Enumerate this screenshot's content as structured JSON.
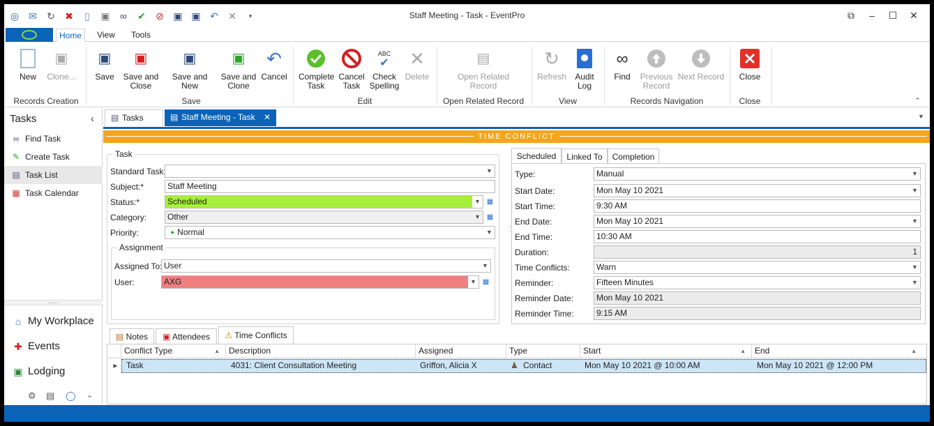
{
  "window": {
    "title": "Staff Meeting - Task - EventPro"
  },
  "ribbon": {
    "tabs": [
      "Home",
      "View",
      "Tools"
    ],
    "buttons": {
      "new": "New",
      "clone": "Clone...",
      "save": "Save",
      "save_close": "Save and\nClose",
      "save_new": "Save and New",
      "save_clone": "Save and\nClone",
      "cancel": "Cancel",
      "complete": "Complete\nTask",
      "cancel_task": "Cancel\nTask",
      "spelling": "Check\nSpelling",
      "delete": "Delete",
      "open_related": "Open Related\nRecord",
      "refresh": "Refresh",
      "audit": "Audit\nLog",
      "find": "Find",
      "prev": "Previous\nRecord",
      "next": "Next Record",
      "close": "Close"
    },
    "groups": {
      "records_creation": "Records Creation",
      "save": "Save",
      "edit": "Edit",
      "open_related": "Open Related Record",
      "view": "View",
      "records_navigation": "Records Navigation",
      "close": "Close"
    },
    "spelling_badge": "ABC"
  },
  "sidebar": {
    "title": "Tasks",
    "items": [
      "Find Task",
      "Create Task",
      "Task List",
      "Task Calendar"
    ],
    "grip": "......",
    "big_items": [
      "My Workplace",
      "Events",
      "Lodging"
    ]
  },
  "doc_tabs": {
    "tasks": "Tasks",
    "current": "Staff Meeting - Task"
  },
  "banner": "TIME CONFLICT",
  "task": {
    "group_title": "Task",
    "standard_task_label": "Standard Task:",
    "standard_task": "",
    "subject_label": "Subject:*",
    "subject": "Staff Meeting",
    "status_label": "Status:*",
    "status": "Scheduled",
    "category_label": "Category:",
    "category": "Other",
    "priority_label": "Priority:",
    "priority": "Normal"
  },
  "assignment": {
    "group_title": "Assignment",
    "assigned_to_label": "Assigned To:",
    "assigned_to": "User",
    "user_label": "User:",
    "user": "AXG"
  },
  "schedule_tabs": [
    "Scheduled",
    "Linked To",
    "Completion"
  ],
  "schedule": {
    "type_label": "Type:",
    "type": "Manual",
    "start_date_label": "Start Date:",
    "start_date": "Mon May 10 2021",
    "start_time_label": "Start Time:",
    "start_time": "9:30 AM",
    "end_date_label": "End Date:",
    "end_date": "Mon May 10 2021",
    "end_time_label": "End Time:",
    "end_time": "10:30 AM",
    "duration_label": "Duration:",
    "duration": "1",
    "conflicts_label": "Time Conflicts:",
    "conflicts": "Warn",
    "reminder_label": "Reminder:",
    "reminder": "Fifteen Minutes",
    "reminder_date_label": "Reminder Date:",
    "reminder_date": "Mon May 10 2021",
    "reminder_time_label": "Reminder Time:",
    "reminder_time": "9:15 AM"
  },
  "bottom_tabs": [
    "Notes",
    "Attendees",
    "Time Conflicts"
  ],
  "grid": {
    "columns": [
      "Conflict Type",
      "Description",
      "Assigned",
      "Type",
      "Start",
      "End"
    ],
    "rows": [
      {
        "conflict_type": "Task",
        "description": "4031: Client Consultation Meeting",
        "assigned": "Griffon, Alicia X",
        "type": "Contact",
        "start": "Mon May 10 2021 @ 10:00 AM",
        "end": "Mon May 10 2021 @ 12:00 PM"
      }
    ]
  },
  "colors": {
    "accent": "#0b63b8",
    "banner": "#f5a51c",
    "status_green": "#a6f03c",
    "user_red": "#f08080",
    "grid_selected": "#cde6f7"
  }
}
